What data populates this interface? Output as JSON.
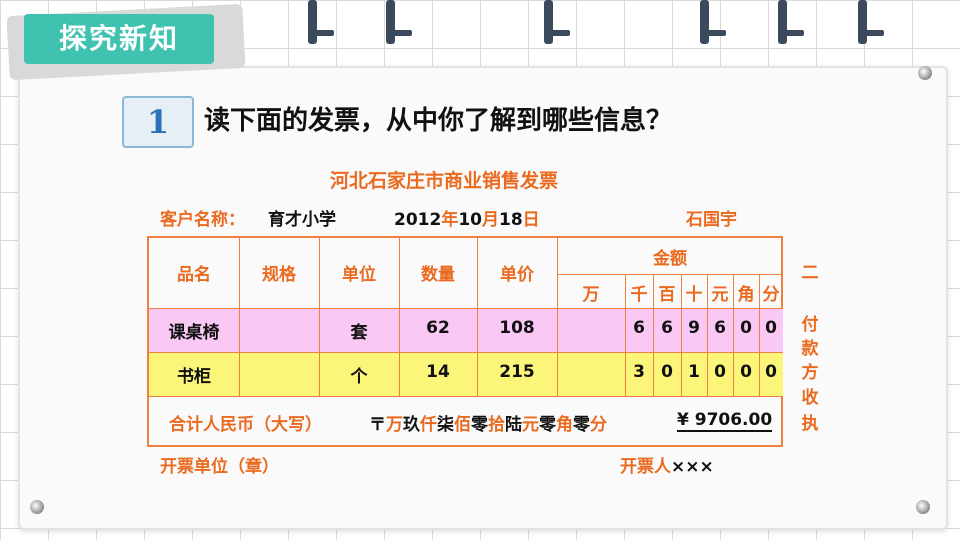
{
  "section_title": "探究新知",
  "question": {
    "number": "1",
    "text": "读下面的发票，从中你了解到哪些信息？"
  },
  "invoice": {
    "title": "河北石家庄市商业销售发票",
    "customer_label": "客户名称：",
    "customer_name": "育才小学",
    "date": {
      "year": "2012",
      "year_unit": "年",
      "month": "10",
      "month_unit": "月",
      "day": "18",
      "day_unit": "日"
    },
    "seller": "石国宇",
    "headers": {
      "name": "品名",
      "spec": "规格",
      "unit": "单位",
      "qty": "数量",
      "price": "单价",
      "amount": "金额",
      "digits": [
        "万",
        "千",
        "百",
        "十",
        "元",
        "角",
        "分"
      ]
    },
    "rows": [
      {
        "name": "课桌椅",
        "spec": "",
        "unit": "套",
        "qty": "62",
        "price": "108",
        "digits": [
          "",
          "6",
          "6",
          "9",
          "6",
          "0",
          "0"
        ]
      },
      {
        "name": "书柜",
        "spec": "",
        "unit": "个",
        "qty": "14",
        "price": "215",
        "digits": [
          "",
          "3",
          "0",
          "1",
          "0",
          "0",
          "0"
        ]
      }
    ],
    "total": {
      "label": "合计人民币（大写）",
      "big": [
        {
          "t": "〒",
          "u": false
        },
        {
          "t": "万",
          "u": true
        },
        {
          "t": "玖",
          "u": false
        },
        {
          "t": "仟",
          "u": true
        },
        {
          "t": "柒",
          "u": false
        },
        {
          "t": "佰",
          "u": true
        },
        {
          "t": "零",
          "u": false
        },
        {
          "t": "拾",
          "u": true
        },
        {
          "t": "陆",
          "u": false
        },
        {
          "t": "元",
          "u": true
        },
        {
          "t": "零",
          "u": false
        },
        {
          "t": "角",
          "u": true
        },
        {
          "t": "零",
          "u": false
        },
        {
          "t": "分",
          "u": true
        }
      ],
      "amount": "¥ 9706.00"
    },
    "side_text": [
      "二",
      "",
      "付",
      "款",
      "方",
      "收",
      "执"
    ],
    "issuer_unit_label": "开票单位（章）",
    "issuer_label": "开票人",
    "issuer_value": "×××"
  },
  "colors": {
    "accent": "#ea6a1f",
    "teal": "#3fc3b0",
    "pink": "#f9c8f4",
    "yellow": "#fbf57a"
  }
}
